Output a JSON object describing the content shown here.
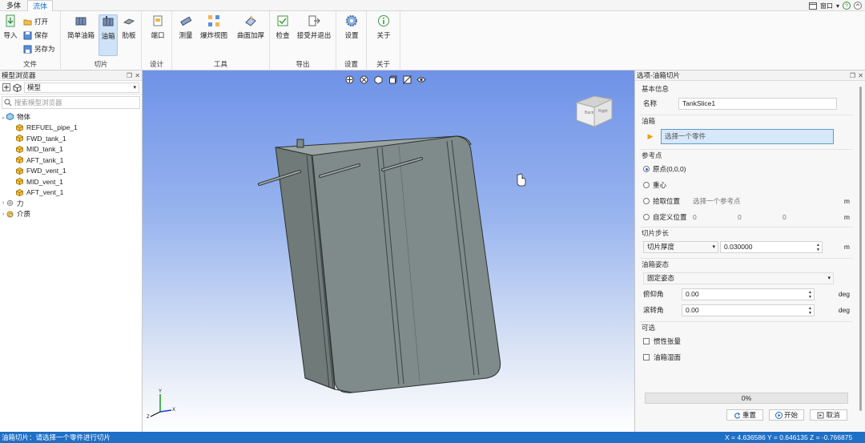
{
  "tabs": [
    "多体",
    "流体"
  ],
  "active_tab": "流体",
  "window_controls": {
    "window_label": "窗口",
    "help": "?"
  },
  "ribbon": {
    "file": {
      "label": "文件",
      "import": "导入",
      "open": "打开",
      "save": "保存",
      "save_as": "另存为"
    },
    "slice": {
      "label": "切片",
      "simple_tank": "简单油箱",
      "tank": "油箱",
      "rib": "肋板"
    },
    "design": {
      "label": "设计",
      "port": "端口"
    },
    "tools": {
      "label": "工具",
      "measure": "测量",
      "explode": "爆炸视图",
      "thicken": "曲面加厚"
    },
    "export": {
      "label": "导出",
      "check": "检查",
      "accept_exit": "接受并退出"
    },
    "settings": {
      "label": "设置",
      "settings": "设置"
    },
    "about": {
      "label": "关于",
      "about": "关于"
    }
  },
  "model_browser": {
    "title": "模型浏览器",
    "model_select": "模型",
    "search_placeholder": "搜索模型浏览器",
    "tree": {
      "bodies_label": "物体",
      "bodies": [
        "REFUEL_pipe_1",
        "FWD_tank_1",
        "MID_tank_1",
        "AFT_tank_1",
        "FWD_vent_1",
        "MID_vent_1",
        "AFT_vent_1"
      ],
      "forces_label": "力",
      "media_label": "介质"
    }
  },
  "viewport": {
    "orientation_cube": {
      "left_face": "Back",
      "right_face": "Right"
    }
  },
  "options_panel": {
    "title": "选项-油箱切片",
    "basic_info": {
      "section": "基本信息",
      "name_label": "名称",
      "name_value": "TankSlice1"
    },
    "tank": {
      "section": "油箱",
      "select_placeholder": "选择一个零件"
    },
    "reference": {
      "section": "参考点",
      "origin": "原点(0,0,0)",
      "centroid": "重心",
      "pick": "拾取位置",
      "pick_placeholder": "选择一个参考点",
      "pick_unit": "m",
      "custom": "自定义位置",
      "custom_x": "0",
      "custom_y": "0",
      "custom_z": "0",
      "custom_unit": "m",
      "selected": "origin"
    },
    "step": {
      "section": "切片步长",
      "mode": "切片厚度",
      "value": "0.030000",
      "unit": "m"
    },
    "attitude": {
      "section": "油箱姿态",
      "mode": "固定姿态",
      "pitch_label": "俯仰角",
      "pitch_value": "0.00",
      "pitch_unit": "deg",
      "roll_label": "滚转角",
      "roll_value": "0.00",
      "roll_unit": "deg"
    },
    "optional": {
      "section": "可选",
      "inertia": "惯性张量",
      "wetted": "油箱湿面"
    },
    "progress": {
      "text": "0%",
      "value": 0
    },
    "buttons": {
      "reset": "重置",
      "start": "开始",
      "cancel": "取消"
    }
  },
  "status": {
    "message": "油箱切片：请选择一个零件进行切片",
    "coords": "X = 4.636586   Y = 0.646135   Z = -0.766875"
  },
  "colors": {
    "accent": "#1e6fc6",
    "tank_body": "#7f8b8a",
    "selected_field": "#d6e8fa"
  }
}
